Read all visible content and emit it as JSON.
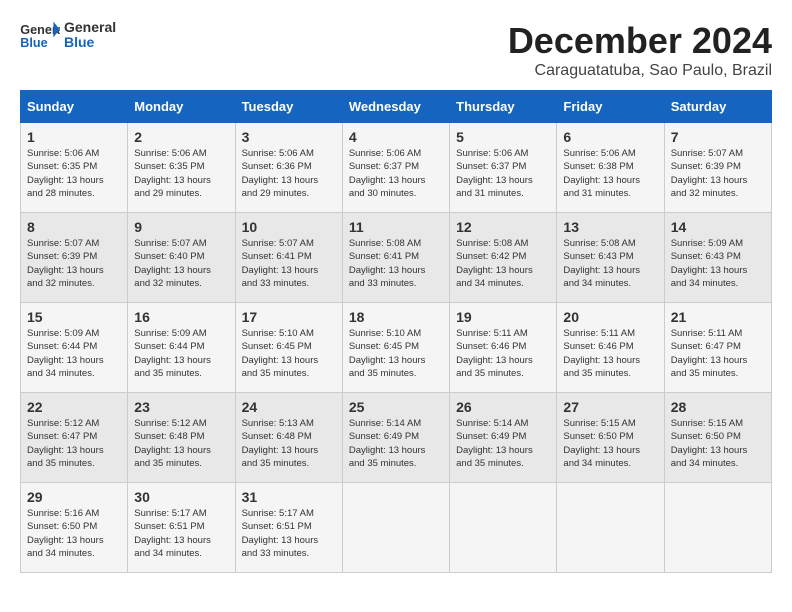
{
  "header": {
    "logo_general": "General",
    "logo_blue": "Blue",
    "month_title": "December 2024",
    "location": "Caraguatatuba, Sao Paulo, Brazil"
  },
  "calendar": {
    "days_of_week": [
      "Sunday",
      "Monday",
      "Tuesday",
      "Wednesday",
      "Thursday",
      "Friday",
      "Saturday"
    ],
    "weeks": [
      [
        {
          "day": "",
          "info": ""
        },
        {
          "day": "2",
          "info": "Sunrise: 5:06 AM\nSunset: 6:35 PM\nDaylight: 13 hours\nand 29 minutes."
        },
        {
          "day": "3",
          "info": "Sunrise: 5:06 AM\nSunset: 6:36 PM\nDaylight: 13 hours\nand 29 minutes."
        },
        {
          "day": "4",
          "info": "Sunrise: 5:06 AM\nSunset: 6:37 PM\nDaylight: 13 hours\nand 30 minutes."
        },
        {
          "day": "5",
          "info": "Sunrise: 5:06 AM\nSunset: 6:37 PM\nDaylight: 13 hours\nand 31 minutes."
        },
        {
          "day": "6",
          "info": "Sunrise: 5:06 AM\nSunset: 6:38 PM\nDaylight: 13 hours\nand 31 minutes."
        },
        {
          "day": "7",
          "info": "Sunrise: 5:07 AM\nSunset: 6:39 PM\nDaylight: 13 hours\nand 32 minutes."
        }
      ],
      [
        {
          "day": "1",
          "info": "Sunrise: 5:06 AM\nSunset: 6:35 PM\nDaylight: 13 hours\nand 28 minutes.",
          "first_col": true
        },
        {
          "day": "9",
          "info": "Sunrise: 5:07 AM\nSunset: 6:40 PM\nDaylight: 13 hours\nand 32 minutes."
        },
        {
          "day": "10",
          "info": "Sunrise: 5:07 AM\nSunset: 6:41 PM\nDaylight: 13 hours\nand 33 minutes."
        },
        {
          "day": "11",
          "info": "Sunrise: 5:08 AM\nSunset: 6:41 PM\nDaylight: 13 hours\nand 33 minutes."
        },
        {
          "day": "12",
          "info": "Sunrise: 5:08 AM\nSunset: 6:42 PM\nDaylight: 13 hours\nand 34 minutes."
        },
        {
          "day": "13",
          "info": "Sunrise: 5:08 AM\nSunset: 6:43 PM\nDaylight: 13 hours\nand 34 minutes."
        },
        {
          "day": "14",
          "info": "Sunrise: 5:09 AM\nSunset: 6:43 PM\nDaylight: 13 hours\nand 34 minutes."
        }
      ],
      [
        {
          "day": "8",
          "info": "Sunrise: 5:07 AM\nSunset: 6:39 PM\nDaylight: 13 hours\nand 32 minutes.",
          "first_col": true
        },
        {
          "day": "16",
          "info": "Sunrise: 5:09 AM\nSunset: 6:44 PM\nDaylight: 13 hours\nand 35 minutes."
        },
        {
          "day": "17",
          "info": "Sunrise: 5:10 AM\nSunset: 6:45 PM\nDaylight: 13 hours\nand 35 minutes."
        },
        {
          "day": "18",
          "info": "Sunrise: 5:10 AM\nSunset: 6:45 PM\nDaylight: 13 hours\nand 35 minutes."
        },
        {
          "day": "19",
          "info": "Sunrise: 5:11 AM\nSunset: 6:46 PM\nDaylight: 13 hours\nand 35 minutes."
        },
        {
          "day": "20",
          "info": "Sunrise: 5:11 AM\nSunset: 6:46 PM\nDaylight: 13 hours\nand 35 minutes."
        },
        {
          "day": "21",
          "info": "Sunrise: 5:11 AM\nSunset: 6:47 PM\nDaylight: 13 hours\nand 35 minutes."
        }
      ],
      [
        {
          "day": "15",
          "info": "Sunrise: 5:09 AM\nSunset: 6:44 PM\nDaylight: 13 hours\nand 34 minutes.",
          "first_col": true
        },
        {
          "day": "23",
          "info": "Sunrise: 5:12 AM\nSunset: 6:48 PM\nDaylight: 13 hours\nand 35 minutes."
        },
        {
          "day": "24",
          "info": "Sunrise: 5:13 AM\nSunset: 6:48 PM\nDaylight: 13 hours\nand 35 minutes."
        },
        {
          "day": "25",
          "info": "Sunrise: 5:14 AM\nSunset: 6:49 PM\nDaylight: 13 hours\nand 35 minutes."
        },
        {
          "day": "26",
          "info": "Sunrise: 5:14 AM\nSunset: 6:49 PM\nDaylight: 13 hours\nand 35 minutes."
        },
        {
          "day": "27",
          "info": "Sunrise: 5:15 AM\nSunset: 6:50 PM\nDaylight: 13 hours\nand 34 minutes."
        },
        {
          "day": "28",
          "info": "Sunrise: 5:15 AM\nSunset: 6:50 PM\nDaylight: 13 hours\nand 34 minutes."
        }
      ],
      [
        {
          "day": "22",
          "info": "Sunrise: 5:12 AM\nSunset: 6:47 PM\nDaylight: 13 hours\nand 35 minutes.",
          "first_col": true
        },
        {
          "day": "30",
          "info": "Sunrise: 5:17 AM\nSunset: 6:51 PM\nDaylight: 13 hours\nand 34 minutes."
        },
        {
          "day": "31",
          "info": "Sunrise: 5:17 AM\nSunset: 6:51 PM\nDaylight: 13 hours\nand 33 minutes."
        },
        {
          "day": "",
          "info": ""
        },
        {
          "day": "",
          "info": ""
        },
        {
          "day": "",
          "info": ""
        },
        {
          "day": "",
          "info": ""
        }
      ],
      [
        {
          "day": "29",
          "info": "Sunrise: 5:16 AM\nSunset: 6:50 PM\nDaylight: 13 hours\nand 34 minutes.",
          "first_col": true
        },
        {
          "day": "",
          "info": ""
        },
        {
          "day": "",
          "info": ""
        },
        {
          "day": "",
          "info": ""
        },
        {
          "day": "",
          "info": ""
        },
        {
          "day": "",
          "info": ""
        },
        {
          "day": "",
          "info": ""
        }
      ]
    ]
  }
}
